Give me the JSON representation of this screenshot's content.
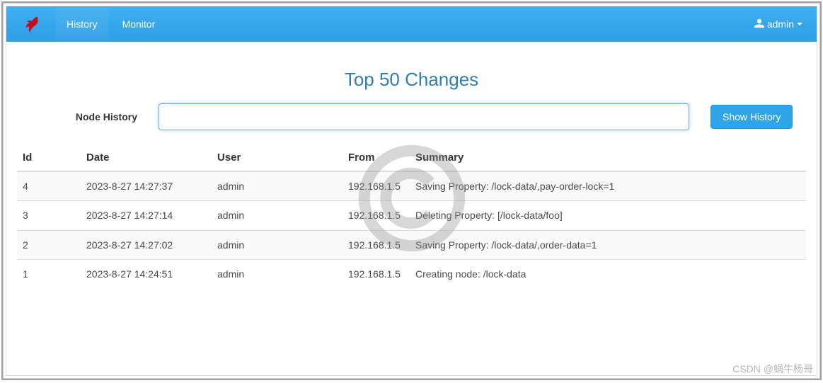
{
  "nav": {
    "history": "History",
    "monitor": "Monitor",
    "user": "admin"
  },
  "page": {
    "title": "Top 50 Changes",
    "form_label": "Node History",
    "input_value": "",
    "button_label": "Show History"
  },
  "table": {
    "headers": {
      "id": "Id",
      "date": "Date",
      "user": "User",
      "from": "From",
      "summary": "Summary"
    },
    "rows": [
      {
        "id": "4",
        "date": "2023-8-27 14:27:37",
        "user": "admin",
        "from": "192.168.1.5",
        "summary": "Saving Property: /lock-data/,pay-order-lock=1"
      },
      {
        "id": "3",
        "date": "2023-8-27 14:27:14",
        "user": "admin",
        "from": "192.168.1.5",
        "summary": "Deleting Property: [/lock-data/foo]"
      },
      {
        "id": "2",
        "date": "2023-8-27 14:27:02",
        "user": "admin",
        "from": "192.168.1.5",
        "summary": "Saving Property: /lock-data/,order-data=1"
      },
      {
        "id": "1",
        "date": "2023-8-27 14:24:51",
        "user": "admin",
        "from": "192.168.1.5",
        "summary": "Creating node: /lock-data"
      }
    ]
  },
  "watermark": "CSDN @蜗牛杨哥"
}
